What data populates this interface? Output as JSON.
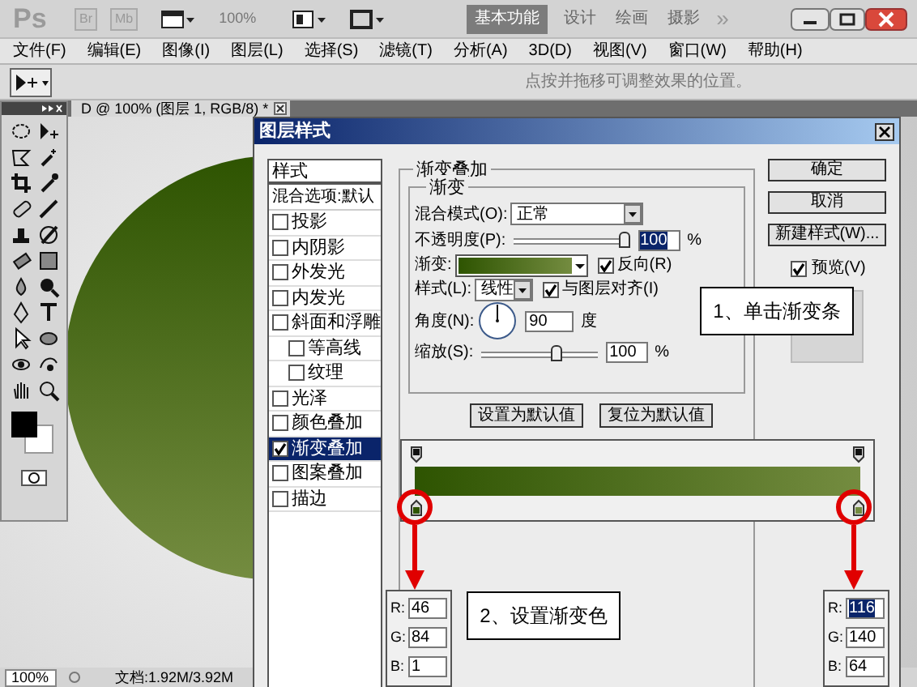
{
  "app_bar": {
    "logo": "Ps",
    "launchers": [
      "Br",
      "Mb"
    ],
    "zoom": "100%",
    "workspaces": [
      {
        "label": "基本功能",
        "selected": true
      },
      {
        "label": "设计",
        "selected": false
      },
      {
        "label": "绘画",
        "selected": false
      },
      {
        "label": "摄影",
        "selected": false
      }
    ],
    "more": "»"
  },
  "menu": [
    "文件(F)",
    "编辑(E)",
    "图像(I)",
    "图层(L)",
    "选择(S)",
    "滤镜(T)",
    "分析(A)",
    "3D(D)",
    "视图(V)",
    "窗口(W)",
    "帮助(H)"
  ],
  "options_bar": {
    "hint": "点按并拖移可调整效果的位置。"
  },
  "document": {
    "tab_title": "D @ 100% (图层 1, RGB/8) *",
    "zoom": "100%",
    "doc_info": "文档:1.92M/3.92M"
  },
  "dialog": {
    "title": "图层样式",
    "styles_header": "样式",
    "blend_options": "混合选项:默认",
    "styles": [
      {
        "label": "投影",
        "checked": false,
        "selected": false
      },
      {
        "label": "内阴影",
        "checked": false,
        "selected": false
      },
      {
        "label": "外发光",
        "checked": false,
        "selected": false
      },
      {
        "label": "内发光",
        "checked": false,
        "selected": false
      },
      {
        "label": "斜面和浮雕",
        "checked": false,
        "selected": false,
        "children": [
          {
            "label": "等高线",
            "checked": false,
            "selected": false
          },
          {
            "label": "纹理",
            "checked": false,
            "selected": false
          }
        ]
      },
      {
        "label": "光泽",
        "checked": false,
        "selected": false
      },
      {
        "label": "颜色叠加",
        "checked": false,
        "selected": false
      },
      {
        "label": "渐变叠加",
        "checked": true,
        "selected": true
      },
      {
        "label": "图案叠加",
        "checked": false,
        "selected": false
      },
      {
        "label": "描边",
        "checked": false,
        "selected": false
      }
    ],
    "section_title": "渐变叠加",
    "group_title": "渐变",
    "blend_mode": {
      "label": "混合模式(O):",
      "value": "正常"
    },
    "opacity": {
      "label": "不透明度(P):",
      "level": 1,
      "value": "100",
      "unit": "%"
    },
    "gradient": {
      "label": "渐变:"
    },
    "reverse": {
      "label": "反向(R)",
      "checked": true
    },
    "style": {
      "label": "样式(L):",
      "value": "线性"
    },
    "align": {
      "label": "与图层对齐(I)",
      "checked": true
    },
    "angle": {
      "label": "角度(N):",
      "value": "90",
      "unit": "度"
    },
    "scale": {
      "label": "缩放(S):",
      "level": 0.66,
      "value": "100",
      "unit": "%"
    },
    "buttons": [
      "设置为默认值",
      "复位为默认值"
    ],
    "side_buttons": [
      "确定",
      "取消",
      "新建样式(W)..."
    ],
    "preview": {
      "label": "预览(V)",
      "checked": true
    }
  },
  "gradient_editor": {
    "stops": [
      {
        "color": "#2e5401"
      },
      {
        "color": "#748c40"
      }
    ]
  },
  "color_fields": [
    [
      {
        "label": "R:",
        "value": "46",
        "selected": false
      },
      {
        "label": "G:",
        "value": "84",
        "selected": false
      },
      {
        "label": "B:",
        "value": "1",
        "selected": false
      }
    ],
    [
      {
        "label": "R:",
        "value": "116",
        "selected": true
      },
      {
        "label": "G:",
        "value": "140",
        "selected": false
      },
      {
        "label": "B:",
        "value": "64",
        "selected": false
      }
    ]
  ],
  "callouts": [
    "1、单击渐变条",
    "2、设置渐变色"
  ]
}
